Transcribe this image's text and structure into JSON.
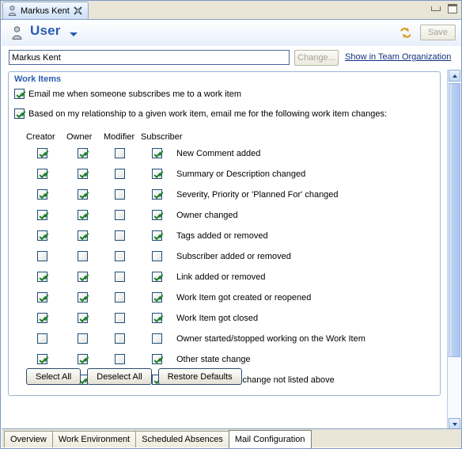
{
  "window": {
    "tab_title": "Markus Kent",
    "minimize_label": "Minimize",
    "maximize_label": "Maximize",
    "close_label": "Close"
  },
  "form_header": {
    "title": "User",
    "save_label": "Save"
  },
  "name_row": {
    "name_value": "Markus Kent",
    "change_label": "Change...",
    "team_link_label": "Show in Team Organization"
  },
  "work_items": {
    "section_title": "Work Items",
    "option_subscribe": {
      "label": "Email me when someone subscribes me to a work item",
      "checked": true
    },
    "option_relationship": {
      "label": "Based on my relationship to a given work item, email me for the following work item changes:",
      "checked": true
    },
    "columns": [
      "Creator",
      "Owner",
      "Modifier",
      "Subscriber"
    ],
    "rows": [
      {
        "label": "New Comment added",
        "checks": [
          true,
          true,
          false,
          true
        ]
      },
      {
        "label": "Summary or Description changed",
        "checks": [
          true,
          true,
          false,
          true
        ]
      },
      {
        "label": "Severity, Priority or 'Planned For' changed",
        "checks": [
          true,
          true,
          false,
          true
        ]
      },
      {
        "label": "Owner changed",
        "checks": [
          true,
          true,
          false,
          true
        ]
      },
      {
        "label": "Tags added or removed",
        "checks": [
          true,
          true,
          false,
          true
        ]
      },
      {
        "label": "Subscriber added or removed",
        "checks": [
          false,
          false,
          false,
          false
        ]
      },
      {
        "label": "Link added or removed",
        "checks": [
          true,
          true,
          false,
          true
        ]
      },
      {
        "label": "Work Item got created or reopened",
        "checks": [
          true,
          true,
          false,
          true
        ]
      },
      {
        "label": "Work Item got closed",
        "checks": [
          true,
          true,
          false,
          true
        ]
      },
      {
        "label": "Owner started/stopped working on the Work Item",
        "checks": [
          false,
          false,
          false,
          false
        ]
      },
      {
        "label": "Other state change",
        "checks": [
          true,
          true,
          false,
          true
        ]
      },
      {
        "label": "Other Work Item change not listed above",
        "checks": [
          true,
          true,
          false,
          true
        ]
      }
    ],
    "buttons": [
      {
        "label": "Select All"
      },
      {
        "label": "Deselect All"
      },
      {
        "label": "Restore Defaults"
      }
    ]
  },
  "bottom_tabs": [
    {
      "label": "Overview",
      "active": false
    },
    {
      "label": "Work Environment",
      "active": false
    },
    {
      "label": "Scheduled Absences",
      "active": false
    },
    {
      "label": "Mail Configuration",
      "active": true
    }
  ],
  "colors": {
    "accent_blue": "#2a5db0",
    "link_blue": "#10307e",
    "check_green": "#1d7f2b",
    "tab_beige": "#e9e6d8"
  }
}
